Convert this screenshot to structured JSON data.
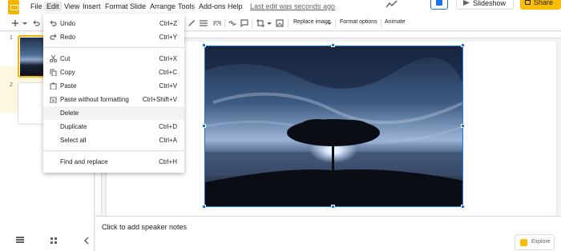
{
  "app": {
    "accent": "#f4b400",
    "selection": "#1a73e8"
  },
  "menubar": {
    "items": [
      "File",
      "Edit",
      "View",
      "Insert",
      "Format",
      "Slide",
      "Arrange",
      "Tools",
      "Add-ons",
      "Help"
    ],
    "last_edit": "Last edit was seconds ago",
    "slideshow_label": "Slideshow",
    "share_label": "Share"
  },
  "toolbar": {
    "replace_image": "Replace image",
    "format_options": "Format options",
    "animate": "Animate"
  },
  "edit_menu": {
    "items": [
      {
        "label": "Undo",
        "shortcut": "Ctrl+Z",
        "icon": "undo-icon"
      },
      {
        "label": "Redo",
        "shortcut": "Ctrl+Y",
        "icon": "redo-icon"
      },
      {
        "label": "Cut",
        "shortcut": "Ctrl+X",
        "icon": "cut-icon"
      },
      {
        "label": "Copy",
        "shortcut": "Ctrl+C",
        "icon": "copy-icon"
      },
      {
        "label": "Paste",
        "shortcut": "Ctrl+V",
        "icon": "paste-icon"
      },
      {
        "label": "Paste without formatting",
        "shortcut": "Ctrl+Shift+V",
        "icon": "paste-plain-icon"
      },
      {
        "label": "Delete",
        "shortcut": "",
        "icon": ""
      },
      {
        "label": "Duplicate",
        "shortcut": "Ctrl+D",
        "icon": ""
      },
      {
        "label": "Select all",
        "shortcut": "Ctrl+A",
        "icon": ""
      },
      {
        "label": "Find and replace",
        "shortcut": "Ctrl+H",
        "icon": ""
      }
    ]
  },
  "filmstrip": {
    "slides": [
      "1",
      "2"
    ]
  },
  "notes": {
    "placeholder": "Click to add speaker notes"
  },
  "explore": {
    "label": "Explore"
  }
}
